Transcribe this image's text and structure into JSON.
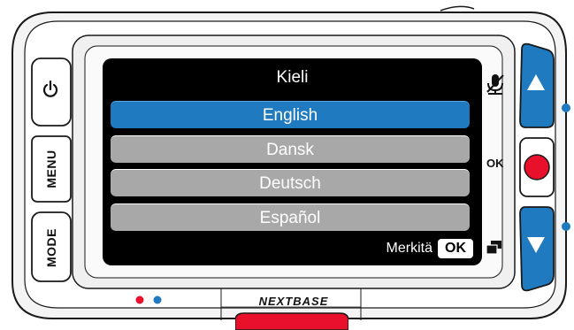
{
  "screen": {
    "title": "Kieli",
    "items": [
      {
        "label": "English",
        "selected": true
      },
      {
        "label": "Dansk",
        "selected": false
      },
      {
        "label": "Deutsch",
        "selected": false
      },
      {
        "label": "Español",
        "selected": false
      }
    ],
    "hint": {
      "text": "Merkitä",
      "key": "OK"
    }
  },
  "buttons": {
    "left": {
      "power_icon": "power-icon",
      "menu": "MENU",
      "mode": "MODE"
    },
    "right": {
      "up_icon": "triangle-up-icon",
      "ok_label": "OK",
      "record_icon": "record-icon",
      "down_icon": "triangle-down-icon"
    }
  },
  "side_icons": {
    "mic": "microphone-muted-icon",
    "protect": "protect-file-icon"
  },
  "brand": "NEXTBASE",
  "colors": {
    "selected": "#1f7ac0",
    "unselected": "#a8a8a8",
    "nav_button": "#1f7ac0",
    "record": "#e8102a",
    "led_red": "#e8102a",
    "led_blue": "#1f7ac0"
  }
}
